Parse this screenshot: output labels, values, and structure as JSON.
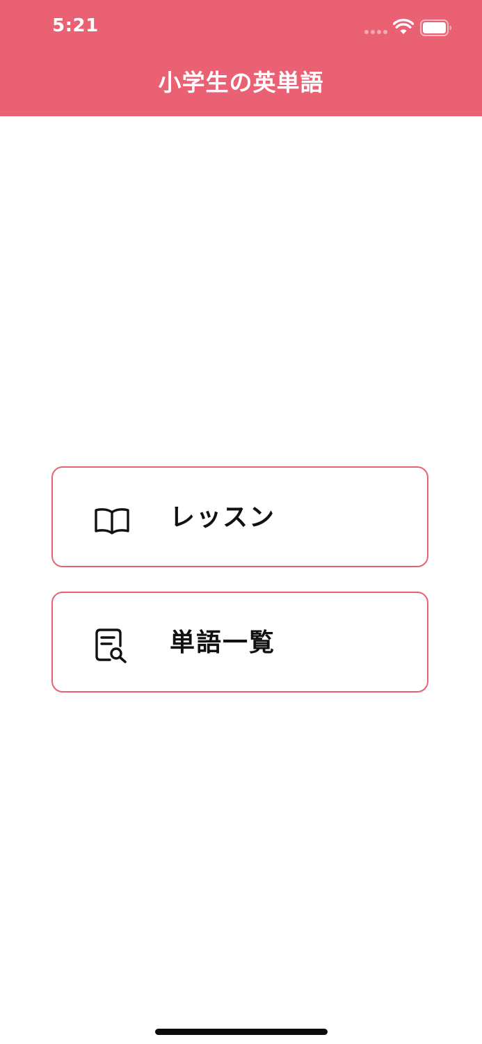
{
  "status_bar": {
    "time": "5:21"
  },
  "header": {
    "title": "小学生の英単語",
    "background_color": "#EA6174"
  },
  "menu": {
    "items": [
      {
        "label": "レッスン",
        "icon": "book-open-icon"
      },
      {
        "label": "単語一覧",
        "icon": "document-search-icon"
      }
    ]
  },
  "colors": {
    "accent": "#EA6174",
    "text": "#111111",
    "background": "#FFFFFF"
  }
}
